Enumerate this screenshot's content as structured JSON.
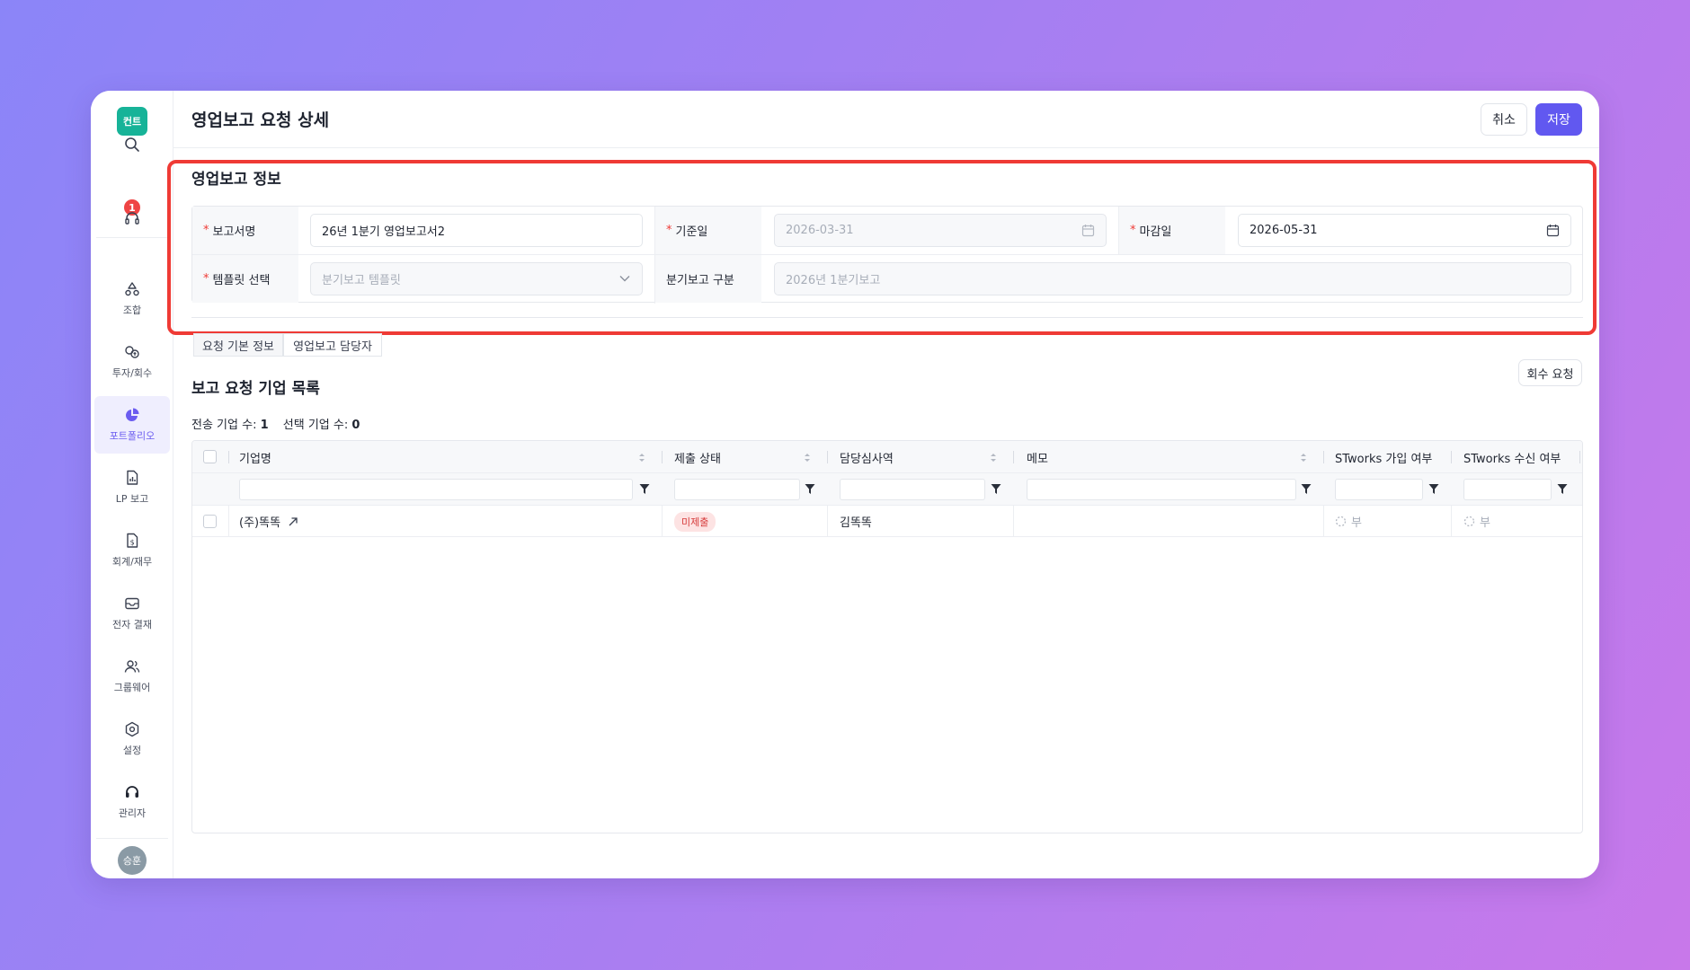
{
  "sidebar": {
    "logo": "컨트",
    "notification_count": "1",
    "items": [
      {
        "label": "조합",
        "icon": "recycle-icon"
      },
      {
        "label": "투자/회수",
        "icon": "invest-icon"
      },
      {
        "label": "포트폴리오",
        "icon": "pie-chart-icon",
        "active": true
      },
      {
        "label": "LP 보고",
        "icon": "report-icon"
      },
      {
        "label": "회계/재무",
        "icon": "accounting-icon"
      },
      {
        "label": "전자 결재",
        "icon": "mail-icon"
      },
      {
        "label": "그룹웨어",
        "icon": "users-icon"
      },
      {
        "label": "설정",
        "icon": "gear-icon"
      },
      {
        "label": "관리자",
        "icon": "headset-icon"
      }
    ],
    "avatar": "승훈"
  },
  "header": {
    "title": "영업보고 요청 상세",
    "cancel_label": "취소",
    "save_label": "저장"
  },
  "info": {
    "title": "영업보고 정보",
    "report_name_label": "보고서명",
    "report_name_value": "26년 1분기 영업보고서2",
    "base_date_label": "기준일",
    "base_date_value": "2026-03-31",
    "deadline_label": "마감일",
    "deadline_value": "2026-05-31",
    "template_label": "템플릿 선택",
    "template_value": "분기보고 템플릿",
    "quarter_label": "분기보고 구분",
    "quarter_value": "2026년 1분기보고"
  },
  "tabs": [
    {
      "label": "요청 기본 정보"
    },
    {
      "label": "영업보고 담당자"
    }
  ],
  "list": {
    "title": "보고 요청 기업 목록",
    "retrieve_label": "회수 요청",
    "sent_label": "전송 기업 수:",
    "sent_count": "1",
    "selected_label": "선택 기업 수:",
    "selected_count": "0"
  },
  "table": {
    "columns": [
      "기업명",
      "제출 상태",
      "담당심사역",
      "메모",
      "STworks 가입 여부",
      "STworks 수신 여부"
    ],
    "rows": [
      {
        "company": "(주)똑똑",
        "status": "미제출",
        "reviewer": "김똑똑",
        "memo": "",
        "joined": "부",
        "received": "부"
      }
    ]
  },
  "colors": {
    "accent": "#6158f0",
    "logo": "#17b398",
    "highlight": "#ef3a35",
    "badge_bg": "#fde3e3",
    "badge_text": "#d63b3b"
  }
}
